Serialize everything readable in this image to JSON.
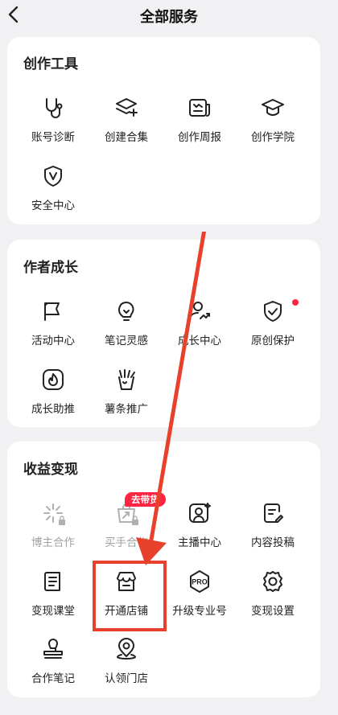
{
  "header": {
    "title": "全部服务"
  },
  "sections": [
    {
      "title": "创作工具",
      "items": [
        {
          "label": "账号诊断",
          "icon": "stethoscope-icon"
        },
        {
          "label": "创建合集",
          "icon": "stack-add-icon"
        },
        {
          "label": "创作周报",
          "icon": "report-icon"
        },
        {
          "label": "创作学院",
          "icon": "graduation-cap-icon"
        },
        {
          "label": "安全中心",
          "icon": "shield-v-icon"
        }
      ]
    },
    {
      "title": "作者成长",
      "items": [
        {
          "label": "活动中心",
          "icon": "flag-icon"
        },
        {
          "label": "笔记灵感",
          "icon": "lightbulb-icon"
        },
        {
          "label": "成长中心",
          "icon": "user-growth-icon"
        },
        {
          "label": "原创保护",
          "icon": "shield-check-icon",
          "dot": true
        },
        {
          "label": "成长助推",
          "icon": "flame-icon"
        },
        {
          "label": "薯条推广",
          "icon": "fries-icon"
        }
      ]
    },
    {
      "title": "收益变现",
      "items": [
        {
          "label": "博主合作",
          "icon": "sparkle-icon",
          "locked": true
        },
        {
          "label": "买手合作",
          "icon": "bag-share-icon",
          "locked": true,
          "badge": "去带货"
        },
        {
          "label": "主播中心",
          "icon": "anchor-portrait-icon"
        },
        {
          "label": "内容投稿",
          "icon": "doc-edit-icon"
        },
        {
          "label": "变现课堂",
          "icon": "notebook-icon"
        },
        {
          "label": "开通店铺",
          "icon": "storefront-icon"
        },
        {
          "label": "升级专业号",
          "icon": "pro-badge-icon"
        },
        {
          "label": "变现设置",
          "icon": "gear-icon"
        },
        {
          "label": "合作笔记",
          "icon": "stamp-icon"
        },
        {
          "label": "认领门店",
          "icon": "location-pin-icon"
        }
      ]
    }
  ],
  "colors": {
    "accent": "#ff2442",
    "annotation": "#e8412b",
    "background": "#f1f1f3"
  }
}
